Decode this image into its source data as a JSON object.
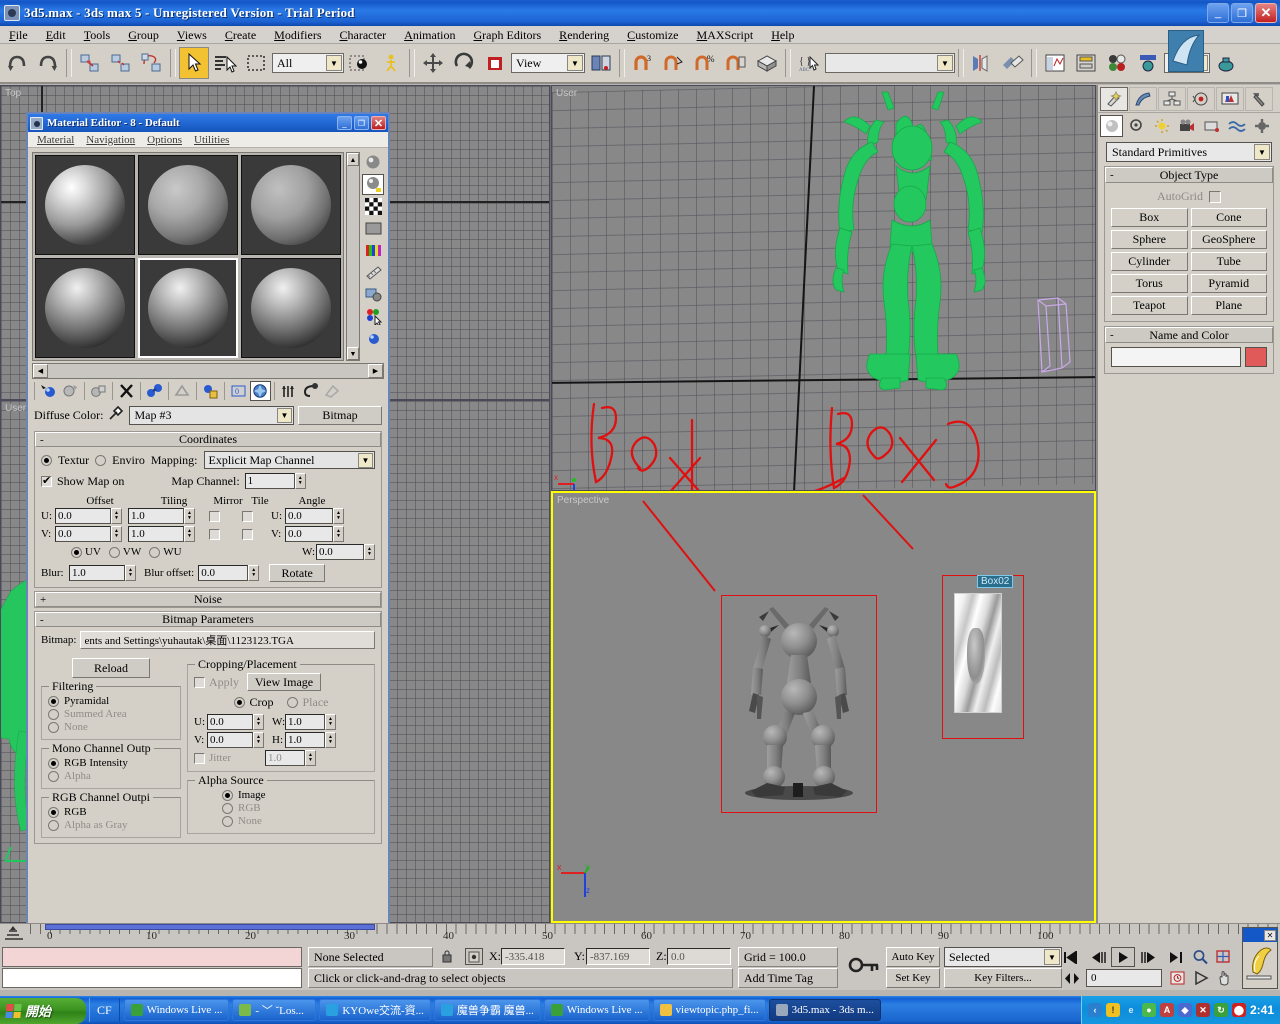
{
  "window": {
    "title": "3d5.max - 3ds max 5 - Unregistered Version - Trial Period",
    "minimize": "_",
    "maximize": "❐",
    "close": "✕"
  },
  "menubar": {
    "items": [
      "File",
      "Edit",
      "Tools",
      "Group",
      "Views",
      "Create",
      "Modifiers",
      "Character",
      "Animation",
      "Graph Editors",
      "Rendering",
      "Customize",
      "MAXScript",
      "Help"
    ]
  },
  "toolbar": {
    "selection_filter": "All",
    "reference_coord": "View",
    "name_field_value": "",
    "icons": [
      "undo-icon",
      "redo-icon",
      "select-link-icon",
      "unlink-icon",
      "bind-space-warp-icon",
      "select-object-icon",
      "select-by-name-icon",
      "rectangular-selection-region-icon",
      "select-region-icon",
      "select-and-manipulate-icon",
      "select-and-move-icon",
      "select-and-rotate-icon",
      "select-and-scale-icon",
      "mirror-icon",
      "align-icon",
      "curve-editor-icon",
      "schematic-view-icon",
      "material-editor-icon",
      "render-scene-icon",
      "render-type-icon",
      "quick-render-icon"
    ]
  },
  "viewports": {
    "top_label": "Top",
    "left_label": "User",
    "user_label": "User",
    "perspective_label": "Perspective",
    "annotations": [
      "Box1",
      "Box2"
    ],
    "selected_object_label": "Box02"
  },
  "command_panel": {
    "tabs": [
      "create-tab",
      "modify-tab",
      "hierarchy-tab",
      "motion-tab",
      "display-tab",
      "utilities-tab"
    ],
    "subtabs": [
      "geometry-icon",
      "shapes-icon",
      "lights-icon",
      "cameras-icon",
      "helpers-icon",
      "space-warps-icon",
      "systems-icon"
    ],
    "category": "Standard Primitives",
    "object_type": {
      "title": "Object Type",
      "autogrid_label": "AutoGrid",
      "buttons": [
        "Box",
        "Cone",
        "Sphere",
        "GeoSphere",
        "Cylinder",
        "Tube",
        "Torus",
        "Pyramid",
        "Teapot",
        "Plane"
      ]
    },
    "name_and_color": {
      "title": "Name and Color",
      "name_value": "",
      "color": "#e05a5a"
    }
  },
  "material_editor": {
    "title": "Material Editor - 8 - Default",
    "minimize": "_",
    "maximize": "❐",
    "close": "✕",
    "menu": [
      "Material",
      "Navigation",
      "Options",
      "Utilities"
    ],
    "slot_count": 6,
    "active_slot_index": 4,
    "vertical_tools": [
      "sample-type-icon",
      "backlight-icon",
      "background-checker-icon",
      "sample-uv-tiling-icon",
      "video-color-check-icon",
      "make-preview-icon",
      "options-icon",
      "select-by-material-icon",
      "material-id-channel-icon"
    ],
    "h_tools": [
      "get-material-icon",
      "put-to-scene-icon",
      "assign-to-selection-icon",
      "reset-map-icon",
      "make-unique-icon",
      "put-to-library-icon",
      "material-effects-channel-icon",
      "show-map-in-viewport-icon",
      "show-end-result-icon",
      "go-to-parent-icon",
      "go-forward-to-sibling-icon"
    ],
    "diffuse_label": "Diffuse Color:",
    "map_name": "Map #3",
    "map_type_button": "Bitmap",
    "coordinates": {
      "title": "Coordinates",
      "texture_label": "Textur",
      "enviro_label": "Enviro",
      "mapping_label": "Mapping:",
      "mapping_value": "Explicit Map Channel",
      "show_map_label": "Show Map on",
      "map_channel_label": "Map Channel:",
      "map_channel_value": "1",
      "col_offset": "Offset",
      "col_tiling": "Tiling",
      "col_mirror": "Mirror",
      "col_tile": "Tile",
      "col_angle": "Angle",
      "u_label": "U:",
      "v_label": "V:",
      "w_label": "W:",
      "offset_u": "0.0",
      "offset_v": "0.0",
      "tiling_u": "1.0",
      "tiling_v": "1.0",
      "angle_u": "0.0",
      "angle_v": "0.0",
      "angle_w": "0.0",
      "uv_label": "UV",
      "vw_label": "VW",
      "wu_label": "WU",
      "blur_label": "Blur:",
      "blur_value": "1.0",
      "blur_offset_label": "Blur offset:",
      "blur_offset_value": "0.0",
      "rotate_button": "Rotate"
    },
    "noise": {
      "title": "Noise",
      "sign": "+"
    },
    "bitmap_parameters": {
      "title": "Bitmap Parameters",
      "sign": "-",
      "bitmap_label": "Bitmap:",
      "bitmap_path": "ents and Settings\\yuhautak\\桌面\\1123123.TGA",
      "reload_button": "Reload",
      "filtering": {
        "title": "Filtering",
        "options": [
          "Pyramidal",
          "Summed Area",
          "None"
        ],
        "selected": "Pyramidal"
      },
      "mono_channel": {
        "title": "Mono Channel Outp",
        "options": [
          "RGB Intensity",
          "Alpha"
        ],
        "selected": "RGB Intensity"
      },
      "rgb_channel": {
        "title": "RGB Channel Outpi",
        "options": [
          "RGB",
          "Alpha as Gray"
        ],
        "selected": "RGB"
      },
      "cropping": {
        "title": "Cropping/Placement",
        "apply_label": "Apply",
        "view_image_button": "View Image",
        "crop_label": "Crop",
        "place_label": "Place",
        "selected_mode": "Crop",
        "u_label": "U:",
        "v_label": "V:",
        "w_label": "W:",
        "h_label": "H:",
        "u_value": "0.0",
        "v_value": "0.0",
        "w_value": "1.0",
        "h_value": "1.0",
        "jitter_label": "Jitter",
        "jitter_value": "1.0"
      },
      "alpha_source": {
        "title": "Alpha Source",
        "options": [
          "Image",
          "RGB",
          "None"
        ],
        "selected": "Image"
      }
    }
  },
  "timebar": {
    "ticks": [
      "0",
      "10",
      "20",
      "30",
      "40",
      "50",
      "60",
      "70",
      "80",
      "90",
      "100"
    ]
  },
  "statusbar": {
    "selection_text": "None Selected",
    "lock_icon": "lock-selection-icon",
    "absolute_mode_icon": "absolute-relative-transform-icon",
    "x_label": "X:",
    "x_value": "-335.418",
    "y_label": "Y:",
    "y_value": "-837.169",
    "z_label": "Z:",
    "z_value": "0.0",
    "grid_text": "Grid = 100.0",
    "add_time_tag": "Add Time Tag",
    "prompt": "Click or click-and-drag to select objects",
    "key_mode_icon": "key-mode-toggle-icon",
    "auto_key": "Auto Key",
    "set_key": "Set Key",
    "key_filter_select": "Selected",
    "key_filters": "Key Filters...",
    "current_frame": "0",
    "nav_icons": [
      "go-to-start-icon",
      "previous-frame-icon",
      "play-animation-icon",
      "next-frame-icon",
      "go-to-end-icon",
      "key-mode-icon",
      "time-configuration-icon",
      "zoom-icon",
      "zoom-all-icon",
      "zoom-extents-icon",
      "pan-icon"
    ]
  },
  "floating_panel": {
    "close": "✕",
    "icon": "render-brush-icon"
  },
  "taskbar": {
    "start": "開始",
    "quicklaunch_label": "CF",
    "items": [
      {
        "label": "Windows Live ...",
        "icon": "messenger-icon",
        "active": false
      },
      {
        "label": "- ﹀      ˇLos...",
        "icon": "app-icon",
        "active": false
      },
      {
        "label": "KYOwe交流-資...",
        "icon": "ie-icon",
        "active": false
      },
      {
        "label": "魔兽争霸 魔兽...",
        "icon": "ie-icon",
        "active": false
      },
      {
        "label": "Windows Live ...",
        "icon": "messenger-icon",
        "active": false
      },
      {
        "label": "viewtopic.php_fi...",
        "icon": "folder-icon",
        "active": false
      },
      {
        "label": "3d5.max - 3ds m...",
        "icon": "max-icon",
        "active": true
      }
    ],
    "clock": "2:41",
    "tray_icons": [
      "show-desktop-icon",
      "warning-icon",
      "ie-icon",
      "user-icon",
      "antivirus-icon",
      "network-icon",
      "update-icon",
      "sync-icon",
      "shield-icon"
    ]
  }
}
